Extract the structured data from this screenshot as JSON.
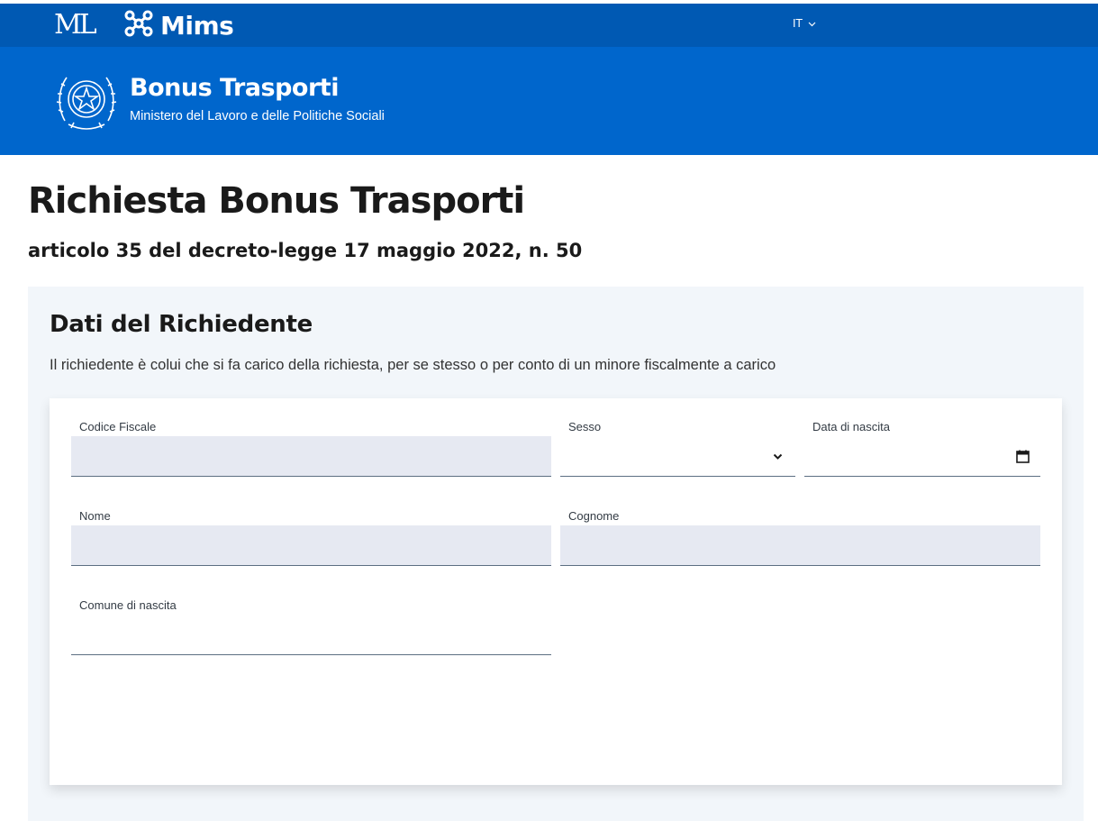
{
  "topbar": {
    "ml_logo": "ML",
    "brand": "Mims",
    "lang": "IT",
    "lang_icon": "chevron-down-icon",
    "brand_icon": "network-nodes-icon"
  },
  "header": {
    "emblem_icon": "italian-republic-emblem-icon",
    "title": "Bonus Trasporti",
    "subtitle": "Ministero del Lavoro e delle Politiche Sociali"
  },
  "page": {
    "title": "Richiesta Bonus Trasporti",
    "subtitle": "articolo 35 del decreto-legge 17 maggio 2022, n. 50"
  },
  "section": {
    "title": "Dati del Richiedente",
    "description": "Il richiedente è colui che si fa carico della richiesta, per se stesso o per conto di un minore fiscalmente a carico"
  },
  "form": {
    "codice_fiscale": {
      "label": "Codice Fiscale",
      "value": ""
    },
    "sesso": {
      "label": "Sesso",
      "value": ""
    },
    "data_nascita": {
      "label": "Data di nascita",
      "value": ""
    },
    "nome": {
      "label": "Nome",
      "value": ""
    },
    "cognome": {
      "label": "Cognome",
      "value": ""
    },
    "comune_nascita": {
      "label": "Comune di nascita",
      "value": ""
    }
  },
  "colors": {
    "topbar_bg": "#0059b3",
    "header_bg": "#0066cc",
    "section_bg": "#f2f6fa",
    "input_bg": "#e6e9f2",
    "input_border": "#5c6f82"
  }
}
